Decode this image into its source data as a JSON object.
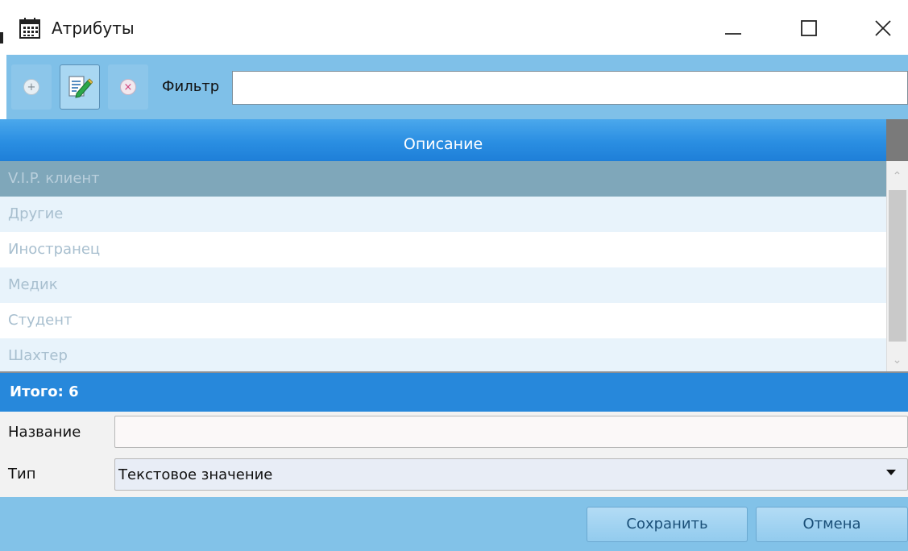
{
  "window": {
    "title": "Атрибуты",
    "icons": {
      "app": "calendar-icon",
      "minimize": "minimize-icon",
      "maximize": "maximize-icon",
      "close": "close-icon"
    }
  },
  "toolbar": {
    "icons": {
      "add": "plus-circle-icon",
      "edit": "pencil-edit-icon",
      "delete": "x-circle-icon"
    },
    "filter_label": "Фильтр",
    "filter_value": ""
  },
  "grid": {
    "column_header": "Описание",
    "rows": [
      {
        "text": "V.I.P. клиент",
        "selected": true
      },
      {
        "text": "Другие"
      },
      {
        "text": "Иностранец"
      },
      {
        "text": "Медик"
      },
      {
        "text": "Студент"
      },
      {
        "text": "Шахтер"
      }
    ],
    "total_label": "Итого: 6"
  },
  "form": {
    "name_label": "Название",
    "name_value": "",
    "type_label": "Тип",
    "type_value": "Текстовое значение"
  },
  "buttons": {
    "save": "Сохранить",
    "cancel": "Отмена"
  },
  "colors": {
    "accent": "#2788db",
    "header_gradient_top": "#4ba8ec",
    "toolbar_bg": "#7fc0e8",
    "selected_row": "#7fa7ba",
    "row_text": "#a8bfcf"
  }
}
